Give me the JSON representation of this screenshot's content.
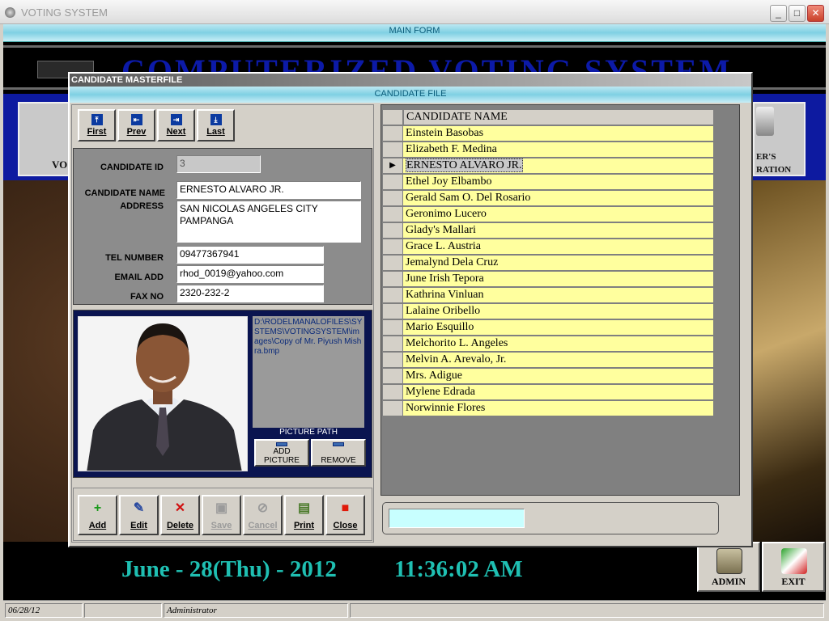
{
  "window": {
    "title": "VOTING SYSTEM",
    "min_label": "_",
    "max_label": "□",
    "close_label": "✕"
  },
  "main_form": {
    "header": "MAIN FORM",
    "banner": "COMPUTERIZED VOTING SYSTEM",
    "left_tile_label": "VO",
    "right_tile_label_1": "ER'S",
    "right_tile_label_2": "RATION",
    "date": "June - 28(Thu) - 2012",
    "time": "11:36:02 AM",
    "admin_label": "ADMIN",
    "exit_label": "EXIT"
  },
  "statusbar": {
    "date": "06/28/12",
    "panel2": "",
    "user": "Administrator",
    "panel4": ""
  },
  "dialog": {
    "title": "CANDIDATE MASTERFILE",
    "header": "CANDIDATE FILE",
    "nav": [
      {
        "label": "First",
        "icon": "first-icon",
        "glyph": "⤒"
      },
      {
        "label": "Prev",
        "icon": "prev-icon",
        "glyph": "⇤"
      },
      {
        "label": "Next",
        "icon": "next-icon",
        "glyph": "⇥"
      },
      {
        "label": "Last",
        "icon": "last-icon",
        "glyph": "⤓"
      }
    ],
    "labels": {
      "id": "CANDIDATE ID",
      "name": "CANDIDATE NAME",
      "address": "ADDRESS",
      "tel": "TEL NUMBER",
      "email": "EMAIL ADD",
      "fax": "FAX NO"
    },
    "values": {
      "id": "3",
      "name": "ERNESTO ALVARO JR.",
      "address": "SAN NICOLAS ANGELES CITY\nPAMPANGA",
      "tel": "09477367941",
      "email": "rhod_0019@yahoo.com",
      "fax": "2320-232-2"
    },
    "picture": {
      "path": "D:\\RODELMANALOFILES\\SYSTEMS\\VOTINGSYSTEM\\images\\Copy of Mr. Piyush Mishra.bmp",
      "path_label": "PICTURE PATH",
      "add_label_1": "ADD",
      "add_label_2": "PICTURE",
      "remove_label": "REMOVE"
    },
    "actions": [
      {
        "label": "Add",
        "icon": "add-icon",
        "glyph": "+",
        "color": "#1a9a1a",
        "enabled": true
      },
      {
        "label": "Edit",
        "icon": "edit-icon",
        "glyph": "✎",
        "color": "#2a4aa0",
        "enabled": true
      },
      {
        "label": "Delete",
        "icon": "delete-icon",
        "glyph": "✕",
        "color": "#d01010",
        "enabled": true
      },
      {
        "label": "Save",
        "icon": "save-icon",
        "glyph": "▣",
        "color": "#9a9a9a",
        "enabled": false
      },
      {
        "label": "Cancel",
        "icon": "cancel-icon",
        "glyph": "⊘",
        "color": "#9a9a9a",
        "enabled": false
      },
      {
        "label": "Print",
        "icon": "print-icon",
        "glyph": "▤",
        "color": "#4a7a2a",
        "enabled": true
      },
      {
        "label": "Close",
        "icon": "close-icon",
        "glyph": "■",
        "color": "#e01a0a",
        "enabled": true
      }
    ],
    "grid": {
      "header": "CANDIDATE NAME",
      "current_marker": "▶",
      "rows": [
        {
          "name": "Einstein Basobas",
          "current": false
        },
        {
          "name": "Elizabeth F. Medina",
          "current": false
        },
        {
          "name": "ERNESTO ALVARO JR.",
          "current": true
        },
        {
          "name": "Ethel Joy Elbambo",
          "current": false
        },
        {
          "name": "Gerald Sam O. Del Rosario",
          "current": false
        },
        {
          "name": "Geronimo Lucero",
          "current": false
        },
        {
          "name": "Glady's Mallari",
          "current": false
        },
        {
          "name": "Grace L. Austria",
          "current": false
        },
        {
          "name": "Jemalynd Dela Cruz",
          "current": false
        },
        {
          "name": "June Irish Tepora",
          "current": false
        },
        {
          "name": "Kathrina Vinluan",
          "current": false
        },
        {
          "name": "Lalaine Oribello",
          "current": false
        },
        {
          "name": "Mario Esquillo",
          "current": false
        },
        {
          "name": "Melchorito L. Angeles",
          "current": false
        },
        {
          "name": "Melvin A. Arevalo, Jr.",
          "current": false
        },
        {
          "name": "Mrs. Adigue",
          "current": false
        },
        {
          "name": "Mylene Edrada",
          "current": false
        },
        {
          "name": "Norwinnie Flores",
          "current": false
        }
      ]
    },
    "search_value": ""
  }
}
